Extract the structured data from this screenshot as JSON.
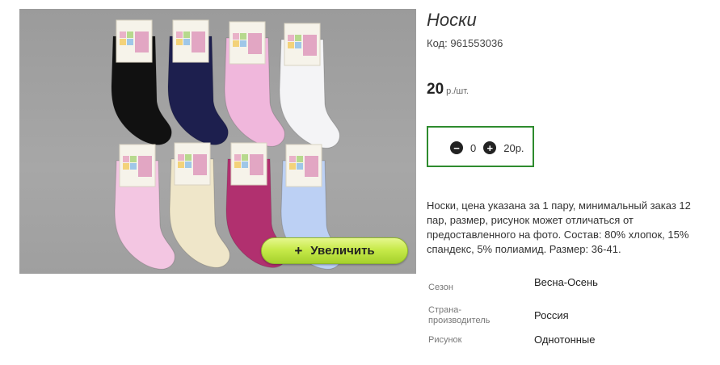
{
  "product": {
    "title": "Носки",
    "code_label": "Код:",
    "code_value": "961553036",
    "price_value": "20",
    "price_unit": "р./шт."
  },
  "gallery": {
    "zoom_plus": "+",
    "zoom_label": "Увеличить"
  },
  "quantity": {
    "minus_icon": "minus-circle-icon",
    "plus_icon": "plus-circle-icon",
    "minus_glyph": "−",
    "plus_glyph": "+",
    "value": "0",
    "total": "20р."
  },
  "description": "Носки, цена указана за 1 пару, минимальный заказ 12 пар, размер, рисунок может отличаться от предоставленного на фото. Состав: 80% хлопок, 15% спандекс, 5% полиамид. Размер: 36-41.",
  "attributes": [
    {
      "label": "Сезон",
      "value": "Весна-Осень"
    },
    {
      "label": "Страна-производитель",
      "value": "Россия"
    },
    {
      "label": "Рисунок",
      "value": "Однотонные"
    }
  ],
  "colors": {
    "accent_border": "#2e8b2e",
    "zoom_button": "#c7ea4a",
    "photo_bg": "#a3a3a3",
    "sock_colors": [
      "#111111",
      "#1d1f4e",
      "#f0b7dc",
      "#f4f4f6",
      "#f3c6e2",
      "#efe6c9",
      "#b1306f",
      "#bcd0f4"
    ]
  }
}
